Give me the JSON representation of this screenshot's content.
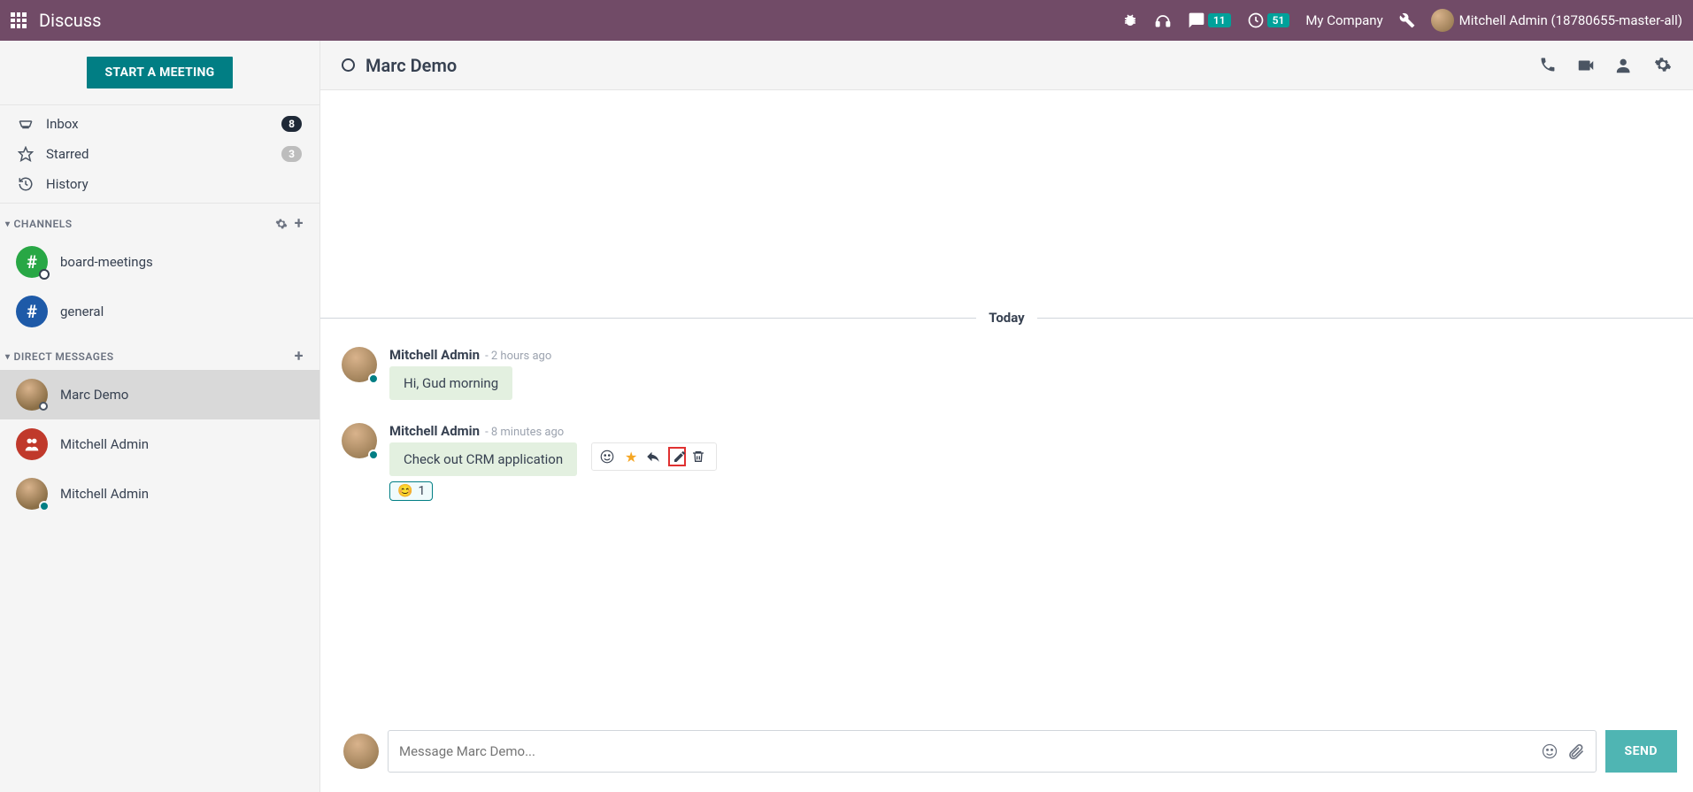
{
  "navbar": {
    "brand": "Discuss",
    "messages_badge": "11",
    "activities_badge": "51",
    "company": "My Company",
    "user": "Mitchell Admin (18780655-master-all)"
  },
  "sidebar": {
    "start_meeting": "START A MEETING",
    "mailboxes": [
      {
        "label": "Inbox",
        "count": "8",
        "pill_class": ""
      },
      {
        "label": "Starred",
        "count": "3",
        "pill_class": "grey"
      },
      {
        "label": "History",
        "count": "",
        "pill_class": ""
      }
    ],
    "channels_header": "CHANNELS",
    "channels": [
      {
        "label": "board-meetings"
      },
      {
        "label": "general"
      }
    ],
    "dm_header": "DIRECT MESSAGES",
    "dms": [
      {
        "label": "Marc Demo"
      },
      {
        "label": "Mitchell Admin"
      },
      {
        "label": "Mitchell Admin"
      }
    ]
  },
  "chat": {
    "title": "Marc Demo",
    "divider": "Today",
    "messages": [
      {
        "author": "Mitchell Admin",
        "time": "- 2 hours ago",
        "body": "Hi, Gud morning"
      },
      {
        "author": "Mitchell Admin",
        "time": "- 8 minutes ago",
        "body": "Check out CRM application",
        "reaction_emoji": "😊",
        "reaction_count": "1"
      }
    ],
    "composer_placeholder": "Message Marc Demo...",
    "send": "SEND"
  }
}
